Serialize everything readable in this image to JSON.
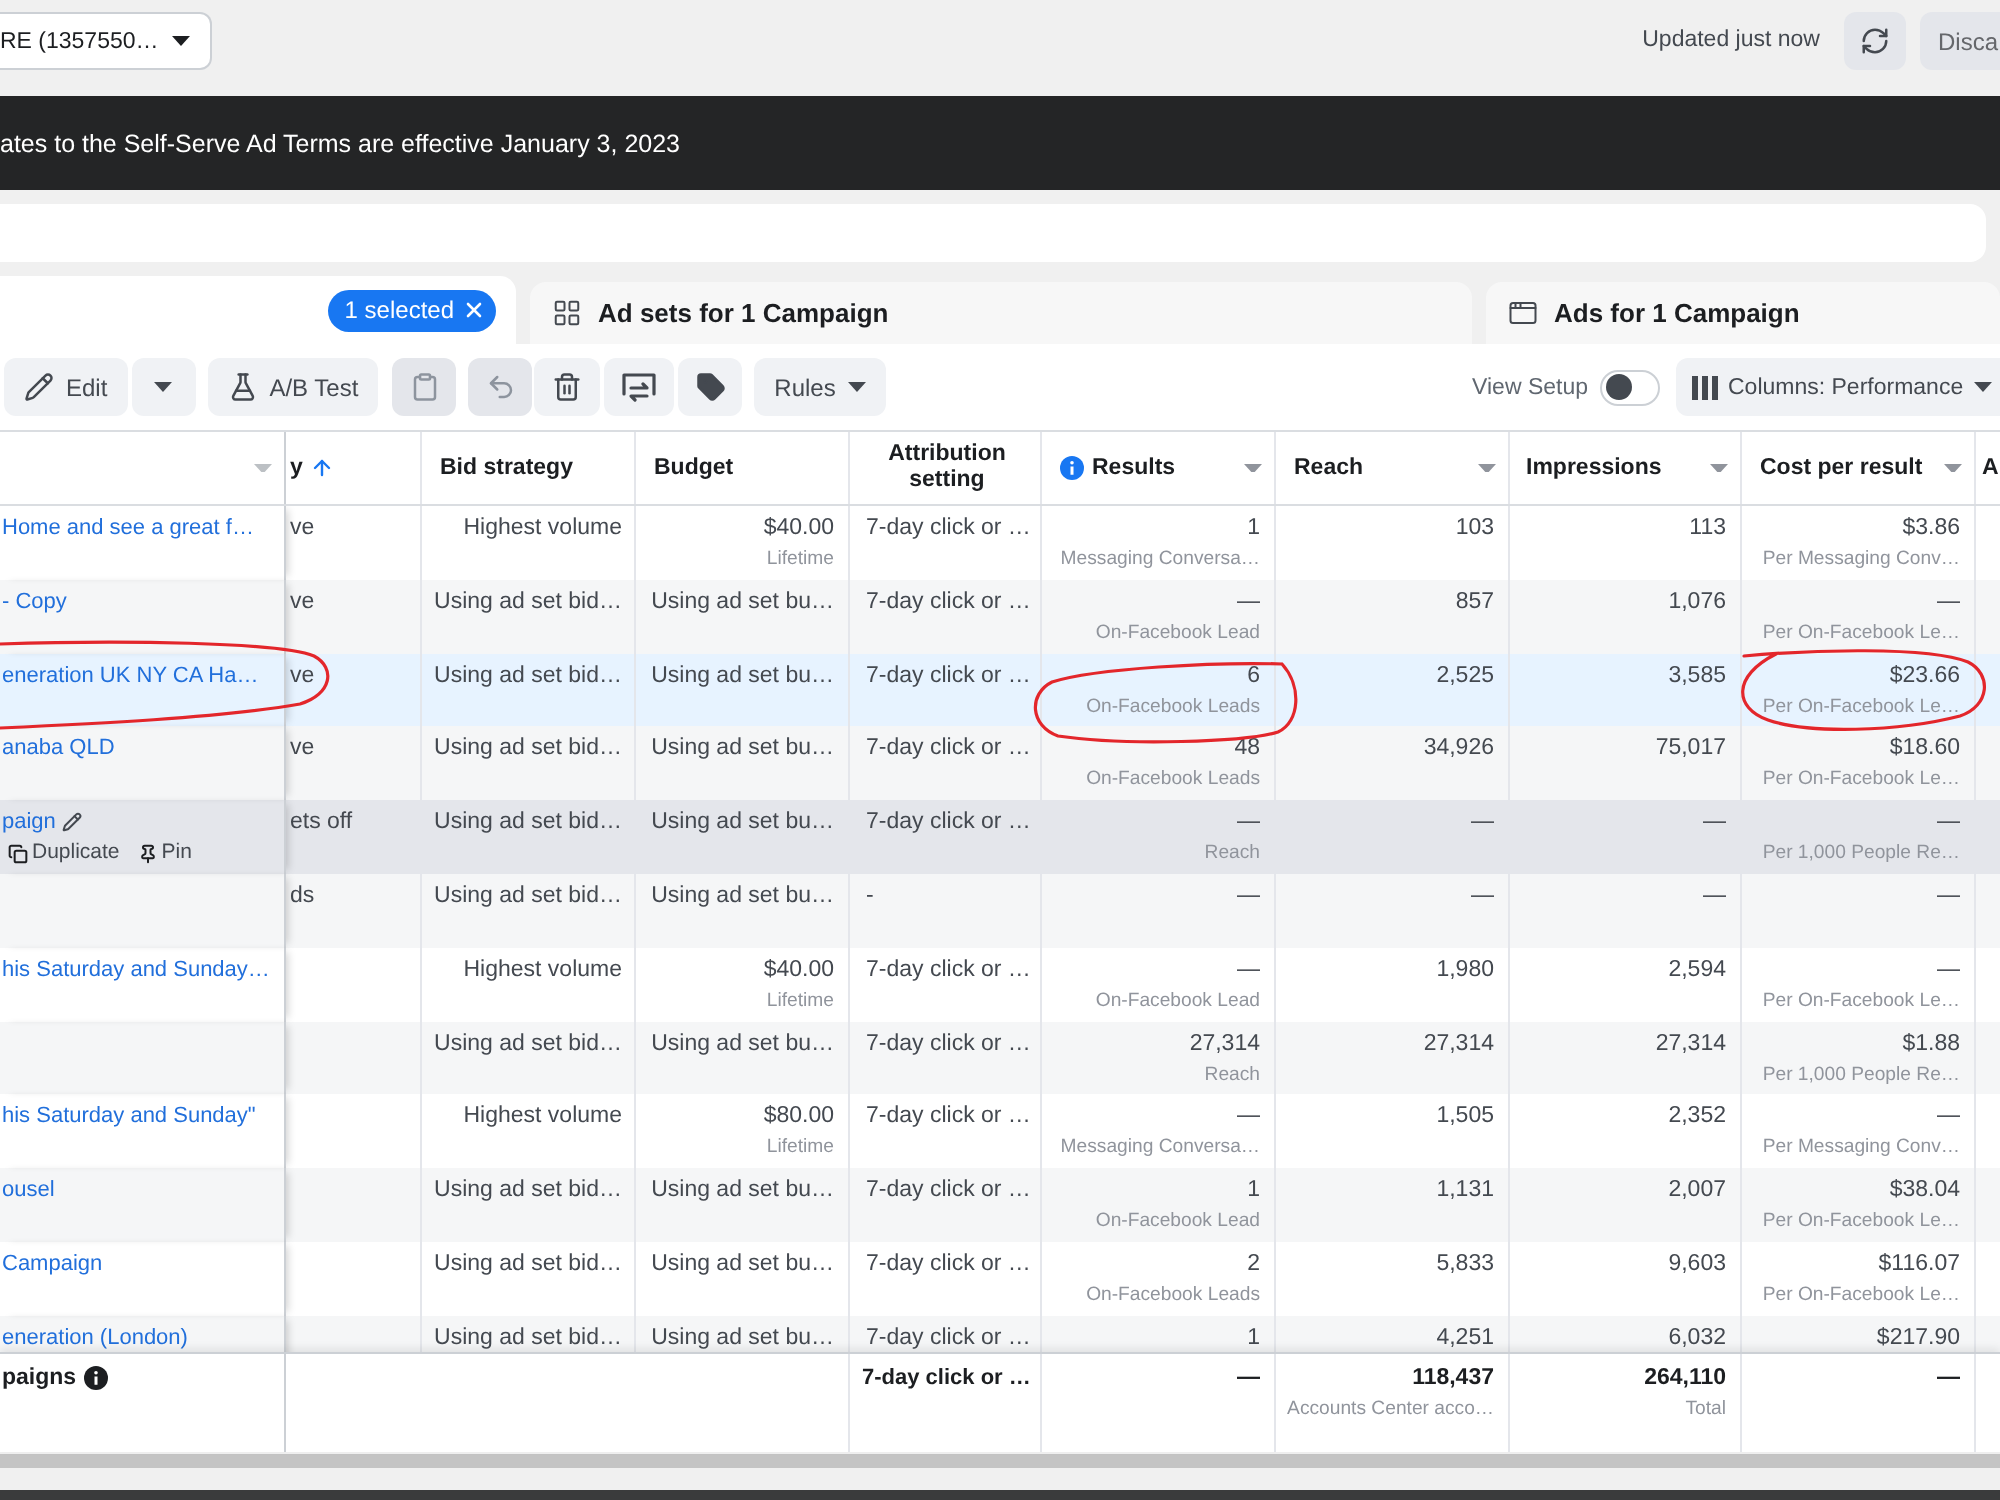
{
  "account_selector": {
    "value": "RE (1357550…"
  },
  "header_actions": {
    "updated": "Updated just now",
    "discard": {
      "label": "Disca",
      "disabled": true
    }
  },
  "banner": {
    "text": "ates to the Self-Serve Ad Terms are effective January 3, 2023"
  },
  "tabs": [
    {
      "kind": "main",
      "selected": true,
      "selection_chip": "1 selected"
    },
    {
      "kind": "ad_sets",
      "label": "Ad sets for 1 Campaign",
      "selected": false
    },
    {
      "kind": "ads",
      "label": "Ads for 1 Campaign",
      "selected": false
    }
  ],
  "toolbar": {
    "buttons": [
      {
        "kind": "edit",
        "label": "Edit",
        "disabled": false
      },
      {
        "kind": "caret",
        "disabled": false
      },
      {
        "kind": "ab_test",
        "label": "A/B Test",
        "disabled": false
      },
      {
        "kind": "clipboard",
        "disabled": true
      },
      {
        "kind": "undo",
        "disabled": true
      },
      {
        "kind": "trash",
        "disabled": false
      },
      {
        "kind": "swap",
        "disabled": false
      },
      {
        "kind": "tag",
        "disabled": false
      },
      {
        "kind": "rules",
        "label": "Rules",
        "disabled": false
      }
    ],
    "view_setup": {
      "label": "View Setup",
      "on": false
    },
    "columns": {
      "label": "Columns: Performance"
    }
  },
  "table": {
    "columns": [
      {
        "menu": true,
        "sorted": false,
        "info": false
      },
      {
        "label": "y",
        "menu": false,
        "sorted": true,
        "info": false
      },
      {
        "label": "Bid strategy",
        "menu": false,
        "sorted": false,
        "info": false
      },
      {
        "label": "Budget",
        "menu": false,
        "sorted": false,
        "info": false
      },
      {
        "label": "Attribution setting",
        "menu": false,
        "sorted": false,
        "info": false
      },
      {
        "label": "Results",
        "menu": true,
        "sorted": false,
        "info": true
      },
      {
        "label": "Reach",
        "menu": true,
        "sorted": false,
        "info": false
      },
      {
        "label": "Impressions",
        "menu": true,
        "sorted": false,
        "info": false
      },
      {
        "label": "Cost per result",
        "menu": true,
        "sorted": false,
        "info": false
      },
      {
        "label": "A",
        "menu": false,
        "sorted": false,
        "info": false
      }
    ],
    "rows": [
      {
        "name": "Home and see a great f…",
        "delivery": "ve",
        "bid_strategy": "Highest volume",
        "budget": "$40.00",
        "budget_note": "Lifetime",
        "attribution": "7-day click or …",
        "results": "1",
        "results_note": "Messaging Conversa…",
        "reach": "103",
        "impressions": "113",
        "cost_per_result": "$3.86",
        "cost_note": "Per Messaging Conv…",
        "selected": false,
        "hovered": false,
        "circled": false
      },
      {
        "name": "- Copy",
        "delivery": "ve",
        "bid_strategy": "Using ad set bid…",
        "budget": "Using ad set bu…",
        "attribution": "7-day click or …",
        "results": "—",
        "results_note": "On-Facebook Lead",
        "reach": "857",
        "impressions": "1,076",
        "cost_per_result": "—",
        "cost_note": "Per On-Facebook Le…",
        "selected": false,
        "hovered": false,
        "circled": false
      },
      {
        "name": "eneration UK NY CA Ha…",
        "delivery": "ve",
        "bid_strategy": "Using ad set bid…",
        "budget": "Using ad set bu…",
        "attribution": "7-day click or …",
        "results": "6",
        "results_note": "On-Facebook Leads",
        "reach": "2,525",
        "impressions": "3,585",
        "cost_per_result": "$23.66",
        "cost_note": "Per On-Facebook Le…",
        "selected": true,
        "hovered": false,
        "circled": true
      },
      {
        "name": "anaba QLD",
        "delivery": "ve",
        "bid_strategy": "Using ad set bid…",
        "budget": "Using ad set bu…",
        "attribution": "7-day click or …",
        "results": "48",
        "results_note": "On-Facebook Leads",
        "reach": "34,926",
        "impressions": "75,017",
        "cost_per_result": "$18.60",
        "cost_note": "Per On-Facebook Le…",
        "selected": false,
        "hovered": false,
        "circled": false
      },
      {
        "name": "paign",
        "actions": [
          {
            "kind": "duplicate",
            "label": "Duplicate"
          },
          {
            "kind": "pin",
            "label": "Pin"
          }
        ],
        "delivery": "ets off",
        "bid_strategy": "Using ad set bid…",
        "budget": "Using ad set bu…",
        "attribution": "7-day click or …",
        "results": "—",
        "results_note": "Reach",
        "reach": "—",
        "impressions": "—",
        "cost_per_result": "—",
        "cost_note": "Per 1,000 People Re…",
        "selected": false,
        "hovered": true,
        "circled": false
      },
      {
        "delivery": "ds",
        "bid_strategy": "Using ad set bid…",
        "budget": "Using ad set bu…",
        "attribution": "-",
        "results": "—",
        "reach": "—",
        "impressions": "—",
        "cost_per_result": "—",
        "selected": false,
        "hovered": false,
        "circled": false
      },
      {
        "name": "his Saturday and Sunday…",
        "bid_strategy": "Highest volume",
        "budget": "$40.00",
        "budget_note": "Lifetime",
        "attribution": "7-day click or …",
        "results": "—",
        "results_note": "On-Facebook Lead",
        "reach": "1,980",
        "impressions": "2,594",
        "cost_per_result": "—",
        "cost_note": "Per On-Facebook Le…",
        "selected": false,
        "hovered": false,
        "circled": false
      },
      {
        "bid_strategy": "Using ad set bid…",
        "budget": "Using ad set bu…",
        "attribution": "7-day click or …",
        "results": "27,314",
        "results_note": "Reach",
        "reach": "27,314",
        "impressions": "27,314",
        "cost_per_result": "$1.88",
        "cost_note": "Per 1,000 People Re…",
        "selected": false,
        "hovered": false,
        "circled": false
      },
      {
        "name": "his Saturday and Sunday\"",
        "bid_strategy": "Highest volume",
        "budget": "$80.00",
        "budget_note": "Lifetime",
        "attribution": "7-day click or …",
        "results": "—",
        "results_note": "Messaging Conversa…",
        "reach": "1,505",
        "impressions": "2,352",
        "cost_per_result": "—",
        "cost_note": "Per Messaging Conv…",
        "selected": false,
        "hovered": false,
        "circled": false
      },
      {
        "name": "ousel",
        "bid_strategy": "Using ad set bid…",
        "budget": "Using ad set bu…",
        "attribution": "7-day click or …",
        "results": "1",
        "results_note": "On-Facebook Lead",
        "reach": "1,131",
        "impressions": "2,007",
        "cost_per_result": "$38.04",
        "cost_note": "Per On-Facebook Le…",
        "selected": false,
        "hovered": false,
        "circled": false
      },
      {
        "name": "Campaign",
        "bid_strategy": "Using ad set bid…",
        "budget": "Using ad set bu…",
        "attribution": "7-day click or …",
        "results": "2",
        "results_note": "On-Facebook Leads",
        "reach": "5,833",
        "impressions": "9,603",
        "cost_per_result": "$116.07",
        "cost_note": "Per On-Facebook Le…",
        "selected": false,
        "hovered": false,
        "circled": false
      },
      {
        "name": "eneration (London)",
        "bid_strategy": "Using ad set bid…",
        "budget": "Using ad set bu…",
        "attribution": "7-day click or …",
        "results": "1",
        "reach": "4,251",
        "impressions": "6,032",
        "cost_per_result": "$217.90",
        "selected": false,
        "hovered": false,
        "circled": false
      }
    ],
    "totals": {
      "label": "paigns",
      "attribution": "7-day click or …",
      "results": "—",
      "reach": "118,437",
      "reach_note": "Accounts Center acco…",
      "impressions": "264,110",
      "impressions_note": "Total",
      "cost_per_result": "—"
    }
  }
}
